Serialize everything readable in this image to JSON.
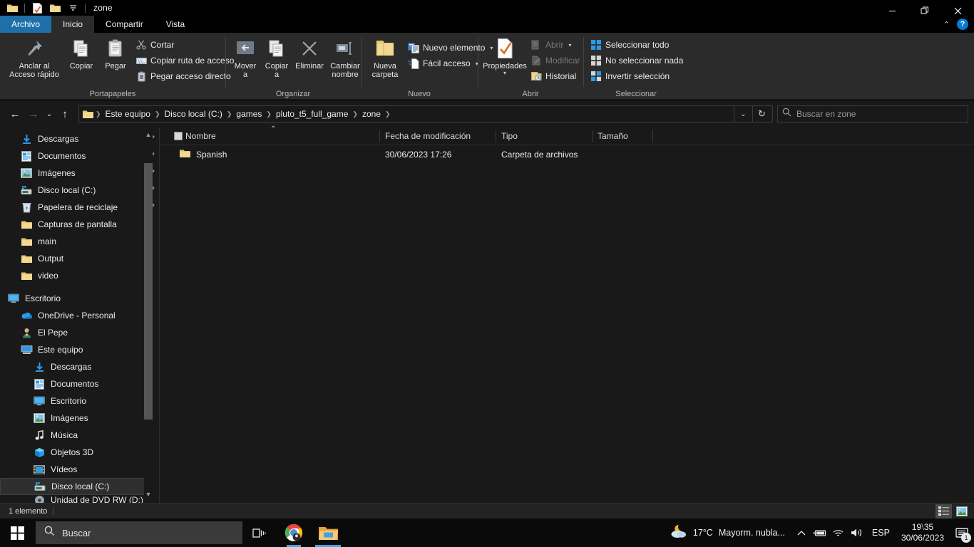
{
  "window": {
    "title": "zone",
    "quick_access": [
      "folder-icon",
      "properties-icon",
      "new-folder-icon",
      "customize-dropdown-icon"
    ],
    "controls": {
      "minimize": "—",
      "restore": "❐",
      "close": "✕",
      "collapse_ribbon": "⌃",
      "help": "?"
    }
  },
  "tabs": [
    {
      "label": "Archivo",
      "kind": "file"
    },
    {
      "label": "Inicio",
      "kind": "active"
    },
    {
      "label": "Compartir",
      "kind": "normal"
    },
    {
      "label": "Vista",
      "kind": "normal"
    }
  ],
  "ribbon": {
    "groups": [
      {
        "label": "Portapapeles",
        "big": [
          {
            "label": "Anclar al\nAcceso rápido",
            "icon": "pin-icon"
          },
          {
            "label": "Copiar",
            "icon": "copy-icon"
          },
          {
            "label": "Pegar",
            "icon": "paste-icon"
          }
        ],
        "small": [
          {
            "label": "Cortar",
            "icon": "scissors-icon",
            "disabled": false
          },
          {
            "label": "Copiar ruta de acceso",
            "icon": "copy-path-icon",
            "disabled": false
          },
          {
            "label": "Pegar acceso directo",
            "icon": "paste-shortcut-icon",
            "disabled": false
          }
        ]
      },
      {
        "label": "Organizar",
        "big": [
          {
            "label": "Mover\na",
            "icon": "move-to-icon",
            "caret": true
          },
          {
            "label": "Copiar\na",
            "icon": "copy-to-icon",
            "caret": true
          },
          {
            "label": "Eliminar",
            "icon": "delete-icon",
            "caret": true
          },
          {
            "label": "Cambiar\nnombre",
            "icon": "rename-icon"
          }
        ],
        "small": []
      },
      {
        "label": "Nuevo",
        "big": [
          {
            "label": "Nueva\ncarpeta",
            "icon": "new-folder-icon"
          }
        ],
        "small": [
          {
            "label": "Nuevo elemento",
            "icon": "new-item-icon",
            "caret": true,
            "disabled": false
          },
          {
            "label": "Fácil acceso",
            "icon": "easy-access-icon",
            "caret": true,
            "disabled": false
          }
        ]
      },
      {
        "label": "Abrir",
        "big": [
          {
            "label": "Propiedades",
            "icon": "properties-icon",
            "caret": true
          }
        ],
        "small": [
          {
            "label": "Abrir",
            "icon": "open-icon",
            "caret": true,
            "disabled": true
          },
          {
            "label": "Modificar",
            "icon": "edit-icon",
            "disabled": true
          },
          {
            "label": "Historial",
            "icon": "history-icon",
            "disabled": false
          }
        ]
      },
      {
        "label": "Seleccionar",
        "big": [],
        "small": [
          {
            "label": "Seleccionar todo",
            "icon": "select-all-icon",
            "disabled": false
          },
          {
            "label": "No seleccionar nada",
            "icon": "select-none-icon",
            "disabled": false
          },
          {
            "label": "Invertir selección",
            "icon": "invert-selection-icon",
            "disabled": false
          }
        ]
      }
    ]
  },
  "addressbar": {
    "back": "←",
    "forward": "→",
    "recent": "⌄",
    "up": "↑",
    "breadcrumbs": [
      "Este equipo",
      "Disco local (C:)",
      "games",
      "pluto_t5_full_game",
      "zone"
    ],
    "dropdown": "⌄",
    "refresh": "↻",
    "search_placeholder": "Buscar en zone"
  },
  "sidebar": {
    "quick_access": [
      {
        "label": "Descargas",
        "icon": "downloads-icon",
        "pinned": true
      },
      {
        "label": "Documentos",
        "icon": "documents-icon",
        "pinned": true
      },
      {
        "label": "Imágenes",
        "icon": "pictures-icon",
        "pinned": true
      },
      {
        "label": "Disco local (C:)",
        "icon": "drive-icon",
        "pinned": true
      },
      {
        "label": "Papelera de reciclaje",
        "icon": "recycle-bin-icon",
        "pinned": true
      },
      {
        "label": "Capturas de pantalla",
        "icon": "folder-icon",
        "pinned": false
      },
      {
        "label": "main",
        "icon": "folder-icon",
        "pinned": false
      },
      {
        "label": "Output",
        "icon": "folder-icon",
        "pinned": false
      },
      {
        "label": "video",
        "icon": "folder-icon",
        "pinned": false
      }
    ],
    "roots": [
      {
        "label": "Escritorio",
        "icon": "desktop-icon",
        "indent": 0
      },
      {
        "label": "OneDrive - Personal",
        "icon": "onedrive-icon",
        "indent": 1
      },
      {
        "label": "El Pepe",
        "icon": "user-icon",
        "indent": 1
      },
      {
        "label": "Este equipo",
        "icon": "this-pc-icon",
        "indent": 1
      }
    ],
    "this_pc": [
      {
        "label": "Descargas",
        "icon": "downloads-icon"
      },
      {
        "label": "Documentos",
        "icon": "documents-icon"
      },
      {
        "label": "Escritorio",
        "icon": "desktop-icon"
      },
      {
        "label": "Imágenes",
        "icon": "pictures-icon"
      },
      {
        "label": "Música",
        "icon": "music-icon"
      },
      {
        "label": "Objetos 3D",
        "icon": "objects3d-icon"
      },
      {
        "label": "Vídeos",
        "icon": "videos-icon"
      },
      {
        "label": "Disco local (C:)",
        "icon": "drive-icon",
        "selected": true
      },
      {
        "label": "Unidad de DVD RW (D:)",
        "icon": "dvd-icon"
      }
    ]
  },
  "filelist": {
    "columns": [
      "Nombre",
      "Fecha de modificación",
      "Tipo",
      "Tamaño"
    ],
    "sort_indicator": "⌃",
    "rows": [
      {
        "name": "Spanish",
        "modified": "30/06/2023 17:26",
        "type": "Carpeta de archivos",
        "size": "",
        "icon": "folder-icon"
      }
    ]
  },
  "statusbar": {
    "count": "1 elemento",
    "views": [
      "details-view-icon",
      "large-icons-view-icon"
    ]
  },
  "taskbar": {
    "start": "windows-logo-icon",
    "search_placeholder": "Buscar",
    "taskview": "task-view-icon",
    "apps": [
      {
        "name": "chrome-icon",
        "state": "running"
      },
      {
        "name": "file-explorer-icon",
        "state": "active"
      }
    ],
    "weather": {
      "temp": "17°C",
      "desc": "Mayorm. nubla...",
      "icon": "partly-cloudy-night-icon"
    },
    "tray": [
      "chevron-up-icon",
      "battery-icon",
      "wifi-icon",
      "volume-icon"
    ],
    "language": "ESP",
    "time": "19⧵35",
    "date": "30/06/2023",
    "notifications": "1"
  },
  "colors": {
    "accent": "#1f6fa8",
    "folder": "#f5de94",
    "ribbon_bg": "#2b2b2b",
    "window_bg": "#191919",
    "taskbar_bg": "#0a0a0a",
    "blue_icon": "#2b9ae8"
  }
}
